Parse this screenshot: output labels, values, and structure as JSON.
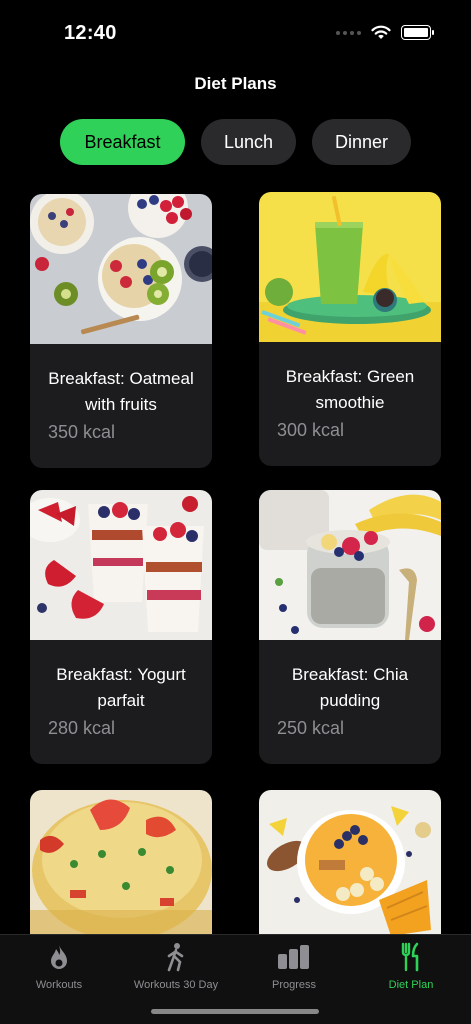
{
  "status_bar": {
    "time": "12:40"
  },
  "nav": {
    "title": "Diet Plans"
  },
  "segments": [
    {
      "label": "Breakfast",
      "selected": true
    },
    {
      "label": "Lunch",
      "selected": false
    },
    {
      "label": "Dinner",
      "selected": false
    }
  ],
  "meals": [
    {
      "name": "Breakfast: Oatmeal with fruits",
      "kcal": "350 kcal",
      "image": "oatmeal-bowls-photo"
    },
    {
      "name": "Breakfast: Green smoothie",
      "kcal": "300 kcal",
      "image": "green-smoothie-photo"
    },
    {
      "name": "Breakfast: Yogurt parfait",
      "kcal": "280 kcal",
      "image": "yogurt-parfait-photo"
    },
    {
      "name": "Breakfast: Chia pudding",
      "kcal": "250 kcal",
      "image": "chia-pudding-photo"
    },
    {
      "name": "",
      "kcal": "",
      "image": "egg-muffin-photo"
    },
    {
      "name": "",
      "kcal": "",
      "image": "smoothie-bowl-photo"
    }
  ],
  "tabs": [
    {
      "label": "Workouts",
      "icon": "flame-icon",
      "selected": false
    },
    {
      "label": "Workouts 30 Day",
      "icon": "walking-figure-icon",
      "selected": false
    },
    {
      "label": "Progress",
      "icon": "bar-chart-icon",
      "selected": false
    },
    {
      "label": "Diet Plan",
      "icon": "fork-knife-icon",
      "selected": true
    }
  ],
  "colors": {
    "accent": "#30d158",
    "background": "#000000",
    "card": "#1c1c1e",
    "inactive": "#8e8e93"
  }
}
